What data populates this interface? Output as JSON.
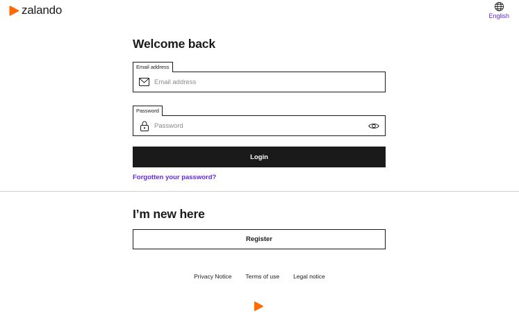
{
  "header": {
    "brand": "zalando",
    "language_label": "English",
    "brand_color": "#ff6900",
    "accent_color": "#6328e0"
  },
  "login": {
    "title": "Welcome back",
    "email_label": "Email address",
    "email_placeholder": "Email address",
    "email_value": "",
    "password_label": "Password",
    "password_placeholder": "Password",
    "password_value": "",
    "submit_label": "Login",
    "forgot_label": "Forgotten your password?"
  },
  "register": {
    "title": "I’m new here",
    "button_label": "Register"
  },
  "footer": {
    "links": [
      "Privacy Notice",
      "Terms of use",
      "Legal notice"
    ]
  },
  "icons": {
    "brand": "zalando-logo-icon",
    "language": "globe-icon",
    "email": "envelope-icon",
    "password": "lock-icon",
    "reveal": "eye-icon"
  }
}
